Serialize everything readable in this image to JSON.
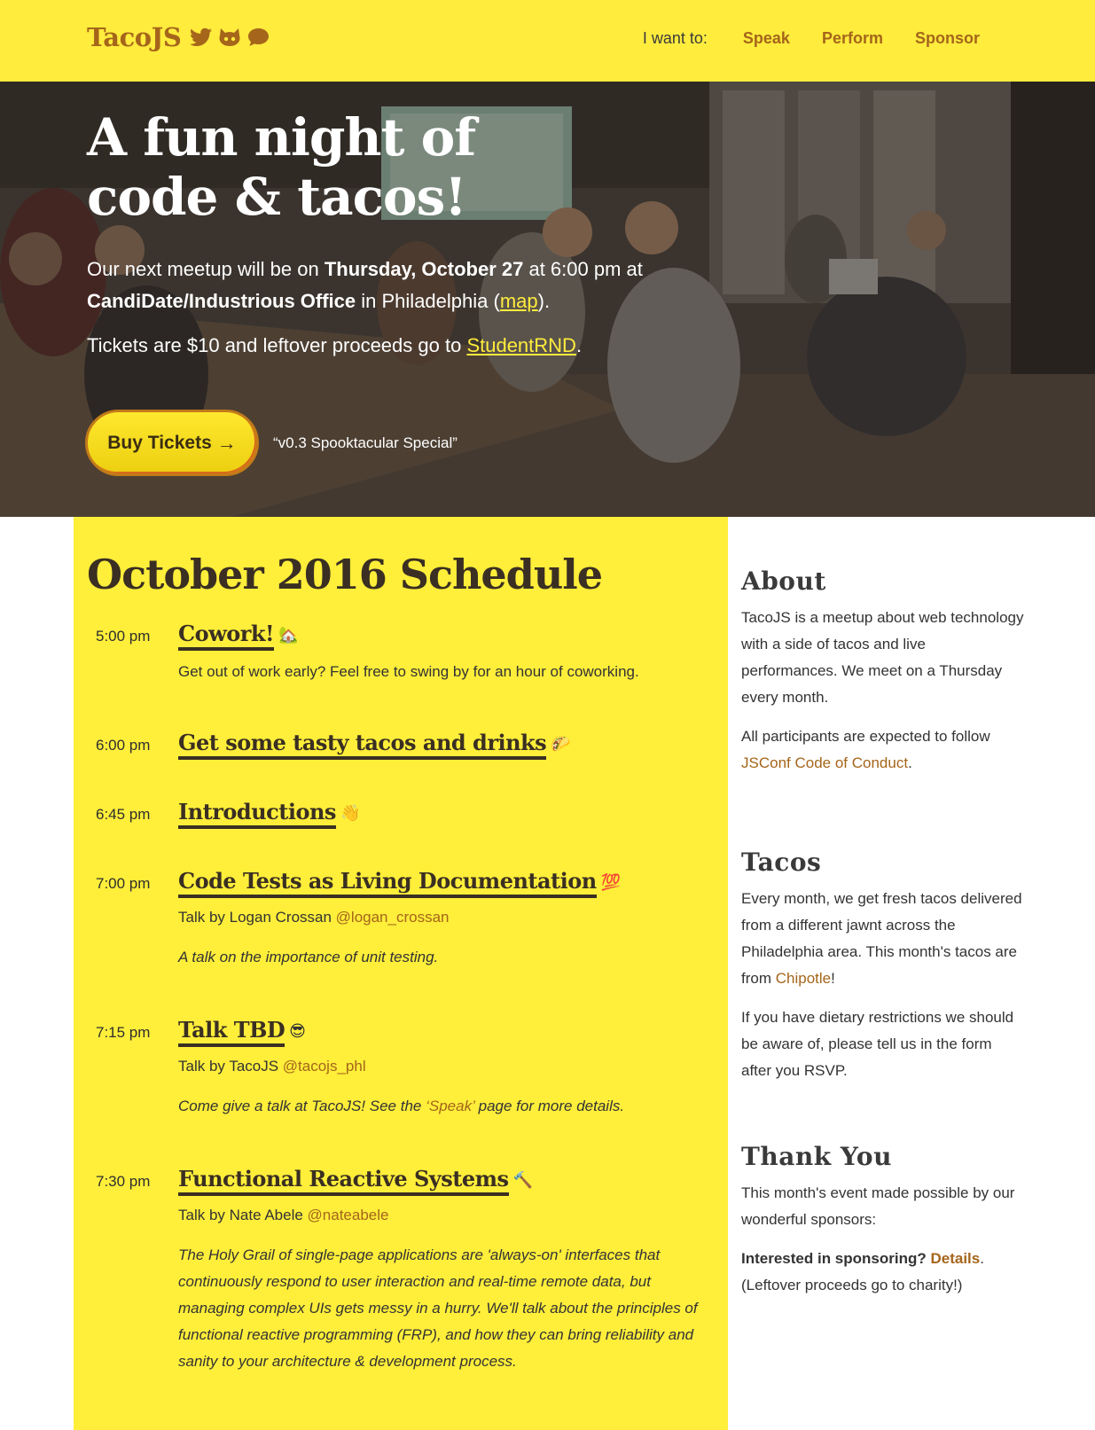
{
  "header": {
    "brand": "TacoJS",
    "social_icons": [
      "twitter-icon",
      "github-icon",
      "chat-icon"
    ],
    "nav_intro": "I want to:",
    "nav": [
      "Speak",
      "Perform",
      "Sponsor"
    ]
  },
  "hero": {
    "title": "A fun night of\ncode & tacos!",
    "meetup_prefix": "Our next meetup will be on ",
    "meetup_date": "Thursday, October 27",
    "meetup_time": " at 6:00 pm at ",
    "venue": "CandiDate/Industrious Office",
    "city": " in Philadelphia (",
    "map_link": "map",
    "city_suffix": ").",
    "tickets_prefix": "Tickets are $10 and leftover proceeds go to ",
    "tickets_link": "StudentRND",
    "tickets_suffix": ".",
    "buy_label": "Buy Tickets",
    "buy_arrow": "→",
    "edition": "“v0.3 Spooktacular Special”"
  },
  "schedule": {
    "title": "October 2016 Schedule",
    "events": [
      {
        "time": "5:00 pm",
        "title": "Cowork!",
        "emoji": "🏡",
        "desc": "Get out of work early? Feel free to swing by for an hour of coworking."
      },
      {
        "time": "6:00 pm",
        "title": "Get some tasty tacos and drinks",
        "emoji": "🌮"
      },
      {
        "time": "6:45 pm",
        "title": "Introductions",
        "emoji": "👋"
      },
      {
        "time": "7:00 pm",
        "title": "Code Tests as Living Documentation",
        "emoji": "💯",
        "speaker_prefix": "Talk by Logan Crossan ",
        "handle": "@logan_crossan",
        "abstract": "A talk on the importance of unit testing."
      },
      {
        "time": "7:15 pm",
        "title": "Talk TBD",
        "emoji": "😎",
        "speaker_prefix": "Talk by TacoJS ",
        "handle": "@tacojs_phl",
        "abstract_prefix": "Come give a talk at TacoJS! See the ",
        "abstract_link": "‘Speak’",
        "abstract_suffix": " page for more details."
      },
      {
        "time": "7:30 pm",
        "title": "Functional Reactive Systems",
        "emoji": "🔨",
        "speaker_prefix": "Talk by Nate Abele ",
        "handle": "@nateabele",
        "abstract": "The Holy Grail of single-page applications are 'always-on' interfaces that continuously respond to user interaction and real-time remote data, but managing complex UIs gets messy in a hurry. We'll talk about the principles of functional reactive programming (FRP), and how they can bring reliability and sanity to your architecture & development process."
      }
    ]
  },
  "sidebar": {
    "about": {
      "heading": "About",
      "p1": "TacoJS is a meetup about web technology with a side of tacos and live performances. We meet on a Thursday every month.",
      "p2_prefix": "All participants are expected to follow ",
      "p2_link": "JSConf Code of Conduct",
      "p2_suffix": "."
    },
    "tacos": {
      "heading": "Tacos",
      "p1_prefix": "Every month, we get fresh tacos delivered from a different jawnt across the Philadelphia area. This month's tacos are from ",
      "p1_link": "Chipotle",
      "p1_suffix": "!",
      "p2": "If you have dietary restrictions we should be aware of, please tell us in the form after you RSVP."
    },
    "thanks": {
      "heading": "Thank You",
      "p1": "This month's event made possible by our wonderful sponsors:",
      "p2_bold": "Interested in sponsoring? ",
      "p2_link": "Details",
      "p2_suffix": ".",
      "p2_note": "(Leftover proceeds go to charity!)"
    }
  },
  "colors": {
    "yellow": "#ffec3d",
    "brown": "#a5651a",
    "dark": "#3a2f22"
  }
}
